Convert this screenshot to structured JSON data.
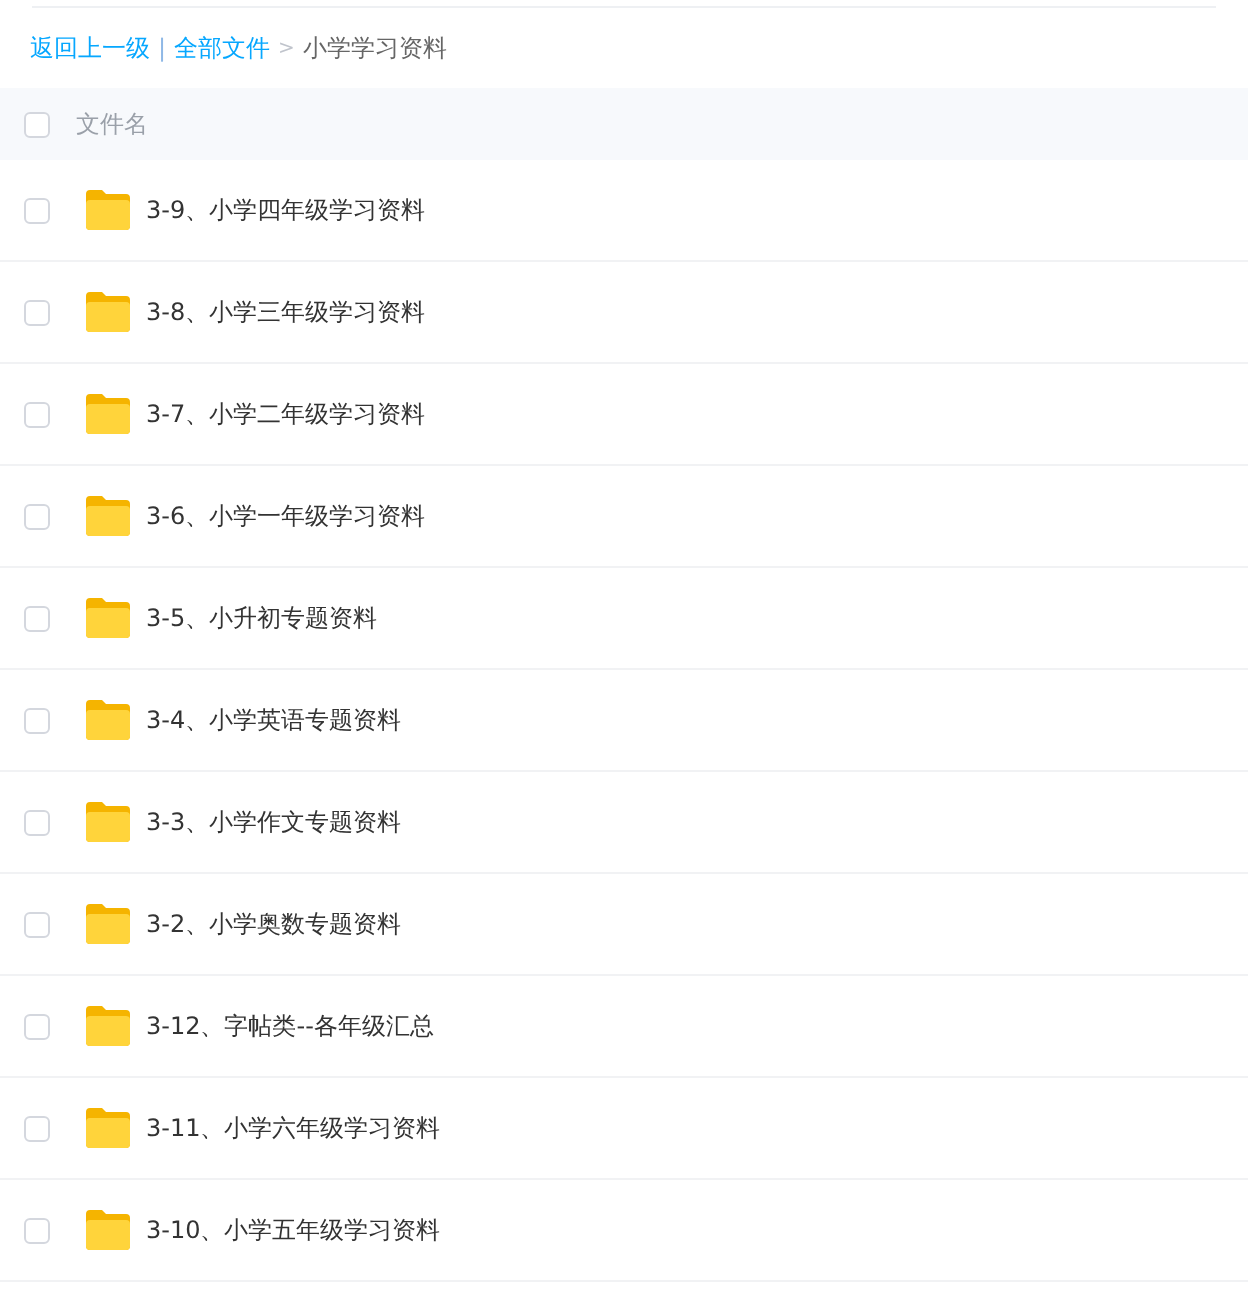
{
  "breadcrumb": {
    "back": "返回上一级",
    "separator": "|",
    "root": "全部文件",
    "arrow": ">",
    "current": "小学学习资料"
  },
  "header": {
    "checked": false,
    "label": "文件名"
  },
  "files": [
    {
      "name": "3-9、小学四年级学习资料",
      "checked": false
    },
    {
      "name": "3-8、小学三年级学习资料",
      "checked": false
    },
    {
      "name": "3-7、小学二年级学习资料",
      "checked": false
    },
    {
      "name": "3-6、小学一年级学习资料",
      "checked": false
    },
    {
      "name": "3-5、小升初专题资料",
      "checked": false
    },
    {
      "name": "3-4、小学英语专题资料",
      "checked": false
    },
    {
      "name": "3-3、小学作文专题资料",
      "checked": false
    },
    {
      "name": "3-2、小学奥数专题资料",
      "checked": false
    },
    {
      "name": "3-12、字帖类--各年级汇总",
      "checked": false
    },
    {
      "name": "3-11、小学六年级学习资料",
      "checked": false
    },
    {
      "name": "3-10、小学五年级学习资料",
      "checked": false
    }
  ]
}
